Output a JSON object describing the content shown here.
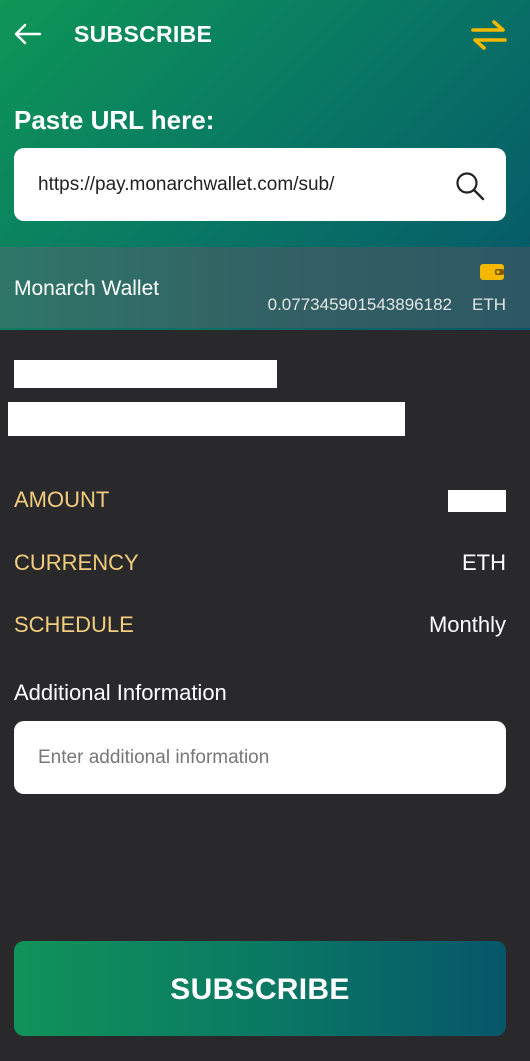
{
  "header": {
    "title": "SUBSCRIBE",
    "back_icon": "arrow-left-icon",
    "swap_icon": "swap-arrows-icon"
  },
  "url_section": {
    "label": "Paste URL here:",
    "value": "https://pay.monarchwallet.com/sub/",
    "search_icon": "search-icon"
  },
  "wallet": {
    "name": "Monarch Wallet",
    "balance": "0.077345901543896182",
    "unit": "ETH",
    "icon": "wallet-icon"
  },
  "details": {
    "amount_label": "AMOUNT",
    "currency_label": "CURRENCY",
    "currency_value": "ETH",
    "schedule_label": "SCHEDULE",
    "schedule_value": "Monthly"
  },
  "additional": {
    "label": "Additional Information",
    "placeholder": "Enter additional information"
  },
  "subscribe_button": {
    "label": "SUBSCRIBE"
  },
  "colors": {
    "background": "#29282b",
    "accent_gold": "#f2cd7d",
    "gradient_start": "#0e9656",
    "gradient_end": "#05566a",
    "icon_yellow": "#f5b800"
  }
}
